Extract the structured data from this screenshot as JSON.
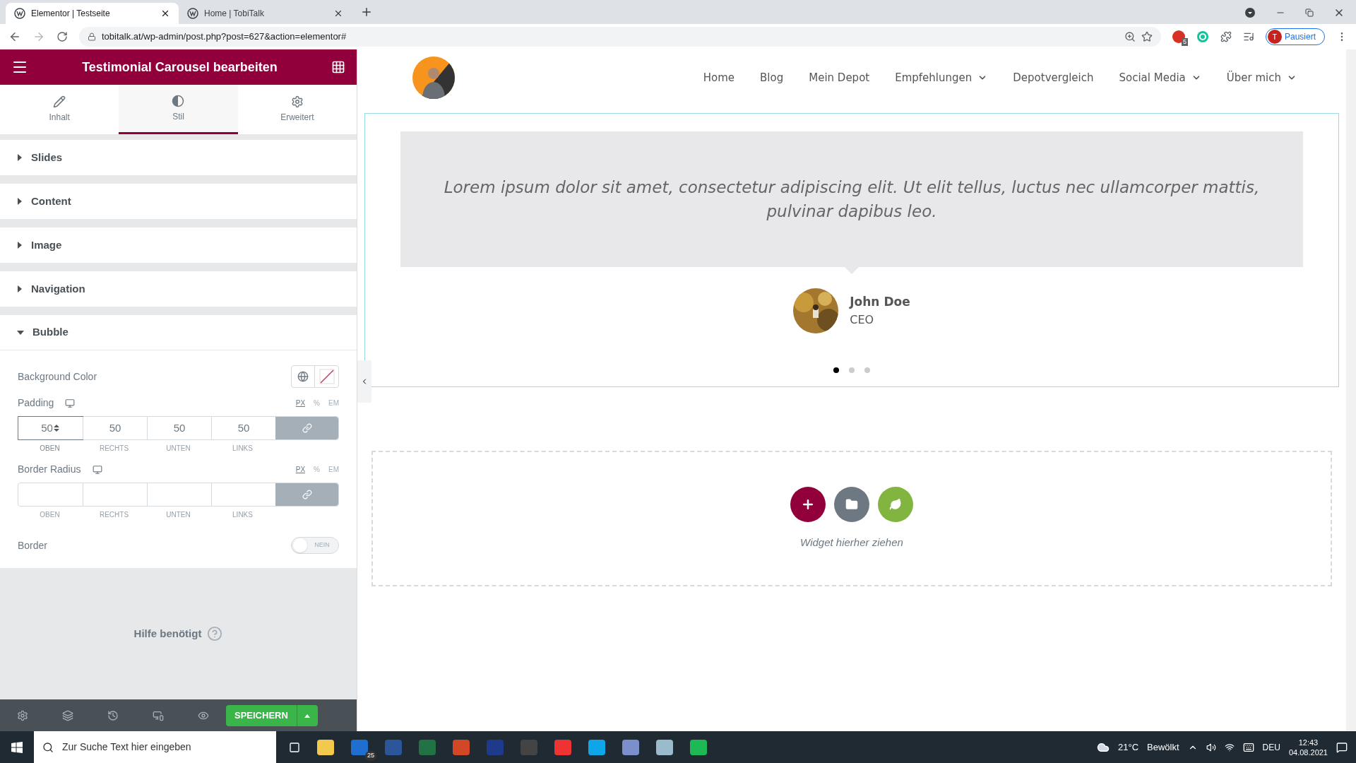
{
  "browser": {
    "tabs": [
      {
        "title": "Elementor | Testseite",
        "selected": true
      },
      {
        "title": "Home | TobiTalk",
        "selected": false
      }
    ],
    "url": "tobitalk.at/wp-admin/post.php?post=627&action=elementor#",
    "extension_badge": "5",
    "profile_initial": "T",
    "profile_label": "Pausiert"
  },
  "panel": {
    "title": "Testimonial Carousel bearbeiten",
    "tabs": [
      {
        "label": "Inhalt",
        "selected": false
      },
      {
        "label": "Stil",
        "selected": true
      },
      {
        "label": "Erweitert",
        "selected": false
      }
    ],
    "sections": [
      {
        "label": "Slides",
        "expanded": false
      },
      {
        "label": "Content",
        "expanded": false
      },
      {
        "label": "Image",
        "expanded": false
      },
      {
        "label": "Navigation",
        "expanded": false
      },
      {
        "label": "Bubble",
        "expanded": true
      }
    ],
    "background_color_label": "Background Color",
    "padding": {
      "label": "Padding",
      "units": [
        {
          "label": "PX",
          "selected": true
        },
        {
          "label": "%",
          "selected": false
        },
        {
          "label": "EM",
          "selected": false
        }
      ],
      "fields": [
        {
          "value": "50",
          "label": "OBEN",
          "focused": true
        },
        {
          "value": "50",
          "label": "RECHTS",
          "focused": false
        },
        {
          "value": "50",
          "label": "UNTEN",
          "focused": false
        },
        {
          "value": "50",
          "label": "LINKS",
          "focused": false
        }
      ]
    },
    "border_radius": {
      "label": "Border Radius",
      "units": [
        {
          "label": "PX",
          "selected": true
        },
        {
          "label": "%",
          "selected": false
        },
        {
          "label": "EM",
          "selected": false
        }
      ],
      "fields": [
        {
          "label": "OBEN"
        },
        {
          "label": "RECHTS"
        },
        {
          "label": "UNTEN"
        },
        {
          "label": "LINKS"
        }
      ]
    },
    "border": {
      "label": "Border",
      "on": false,
      "state_label": "NEIN"
    },
    "help": "Hilfe benötigt",
    "save": "SPEICHERN"
  },
  "site": {
    "nav": [
      {
        "label": "Home",
        "dropdown": false
      },
      {
        "label": "Blog",
        "dropdown": false
      },
      {
        "label": "Mein Depot",
        "dropdown": false
      },
      {
        "label": "Empfehlungen",
        "dropdown": true
      },
      {
        "label": "Depotvergleich",
        "dropdown": false
      },
      {
        "label": "Social Media",
        "dropdown": true
      },
      {
        "label": "Über mich",
        "dropdown": true
      }
    ],
    "testimonial": {
      "quote": "Lorem ipsum dolor sit amet, consectetur adipiscing elit. Ut elit tellus, luctus nec ullamcorper mattis, pulvinar dapibus leo.",
      "name": "John Doe",
      "role": "CEO"
    },
    "dots": [
      {
        "selected": true
      },
      {
        "selected": false
      },
      {
        "selected": false
      }
    ],
    "drop_hint": "Widget hierher ziehen"
  },
  "taskbar": {
    "search_placeholder": "Zur Suche Text hier eingeben",
    "mail_badge": "25",
    "temperature": "21°C",
    "weather": "Bewölkt",
    "language": "DEU",
    "time": "12:43",
    "date": "04.08.2021"
  }
}
